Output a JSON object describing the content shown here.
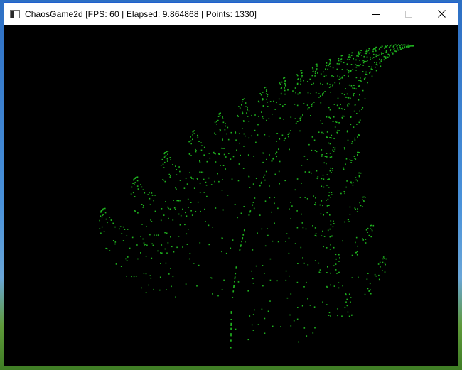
{
  "window": {
    "title": "ChaosGame2d [FPS: 60 | Elapsed: 9.864868 | Points: 1330]",
    "icon": "console-window-icon",
    "buttons": {
      "minimize": "minimize-icon",
      "maximize": "maximize-icon",
      "close": "close-icon"
    }
  },
  "canvas": {
    "background": "#000000",
    "point_color": "#1fb51f",
    "point_count": 1330,
    "figure": "barnsley-fern"
  },
  "colors": {
    "title_bar": "#ffffff",
    "window_border": "#1f5fcf",
    "desktop": "#3a7bd5"
  }
}
